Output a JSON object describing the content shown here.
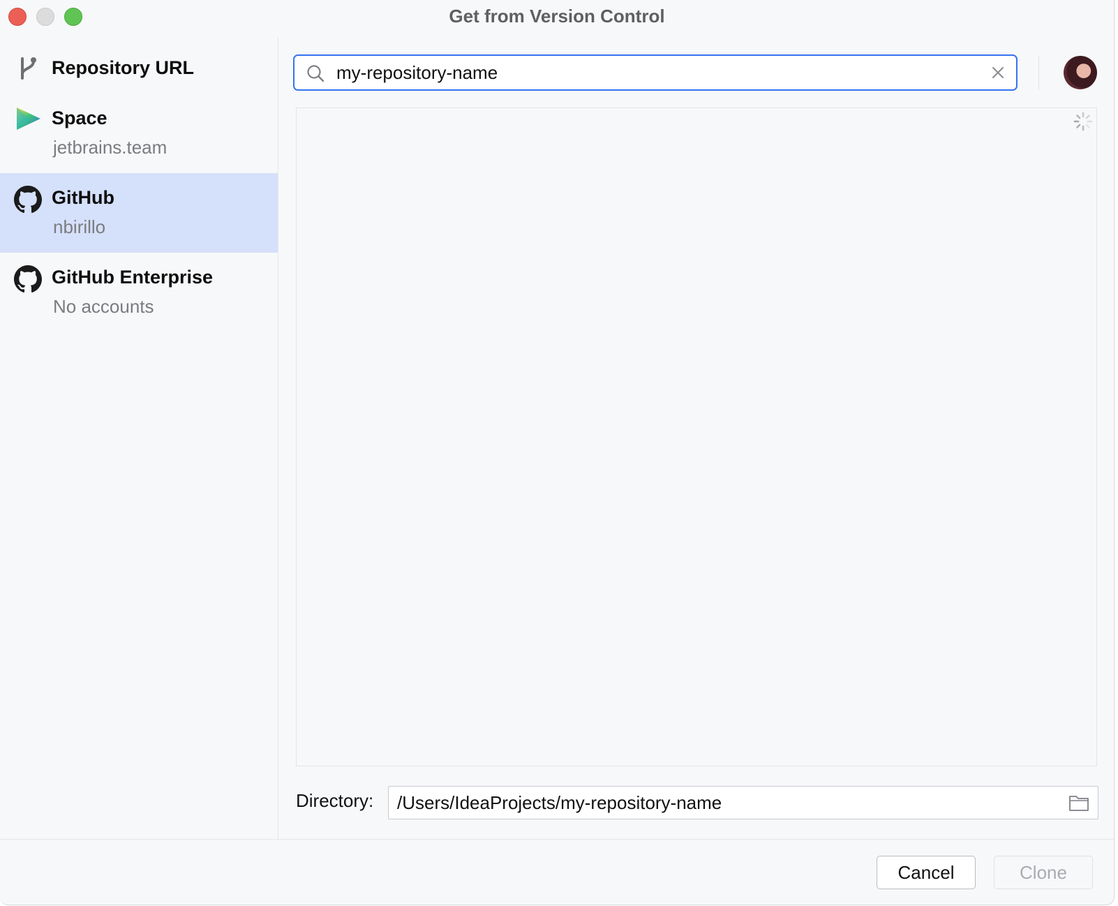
{
  "window": {
    "title": "Get from Version Control"
  },
  "sidebar": {
    "items": [
      {
        "label": "Repository URL",
        "sub": "",
        "icon": "branch-icon",
        "selected": false
      },
      {
        "label": "Space",
        "sub": "jetbrains.team",
        "icon": "space-logo-icon",
        "selected": false
      },
      {
        "label": "GitHub",
        "sub": "nbirillo",
        "icon": "github-icon",
        "selected": true
      },
      {
        "label": "GitHub Enterprise",
        "sub": "No accounts",
        "icon": "github-icon",
        "selected": false
      }
    ]
  },
  "search": {
    "value": "my-repository-name",
    "placeholder": ""
  },
  "directory": {
    "label": "Directory:",
    "value": "/Users/IdeaProjects/my-repository-name"
  },
  "buttons": {
    "cancel": "Cancel",
    "clone": "Clone"
  },
  "colors": {
    "accent": "#3574f0",
    "selected_bg": "#d5e0fa",
    "window_bg": "#f7f8fa"
  }
}
